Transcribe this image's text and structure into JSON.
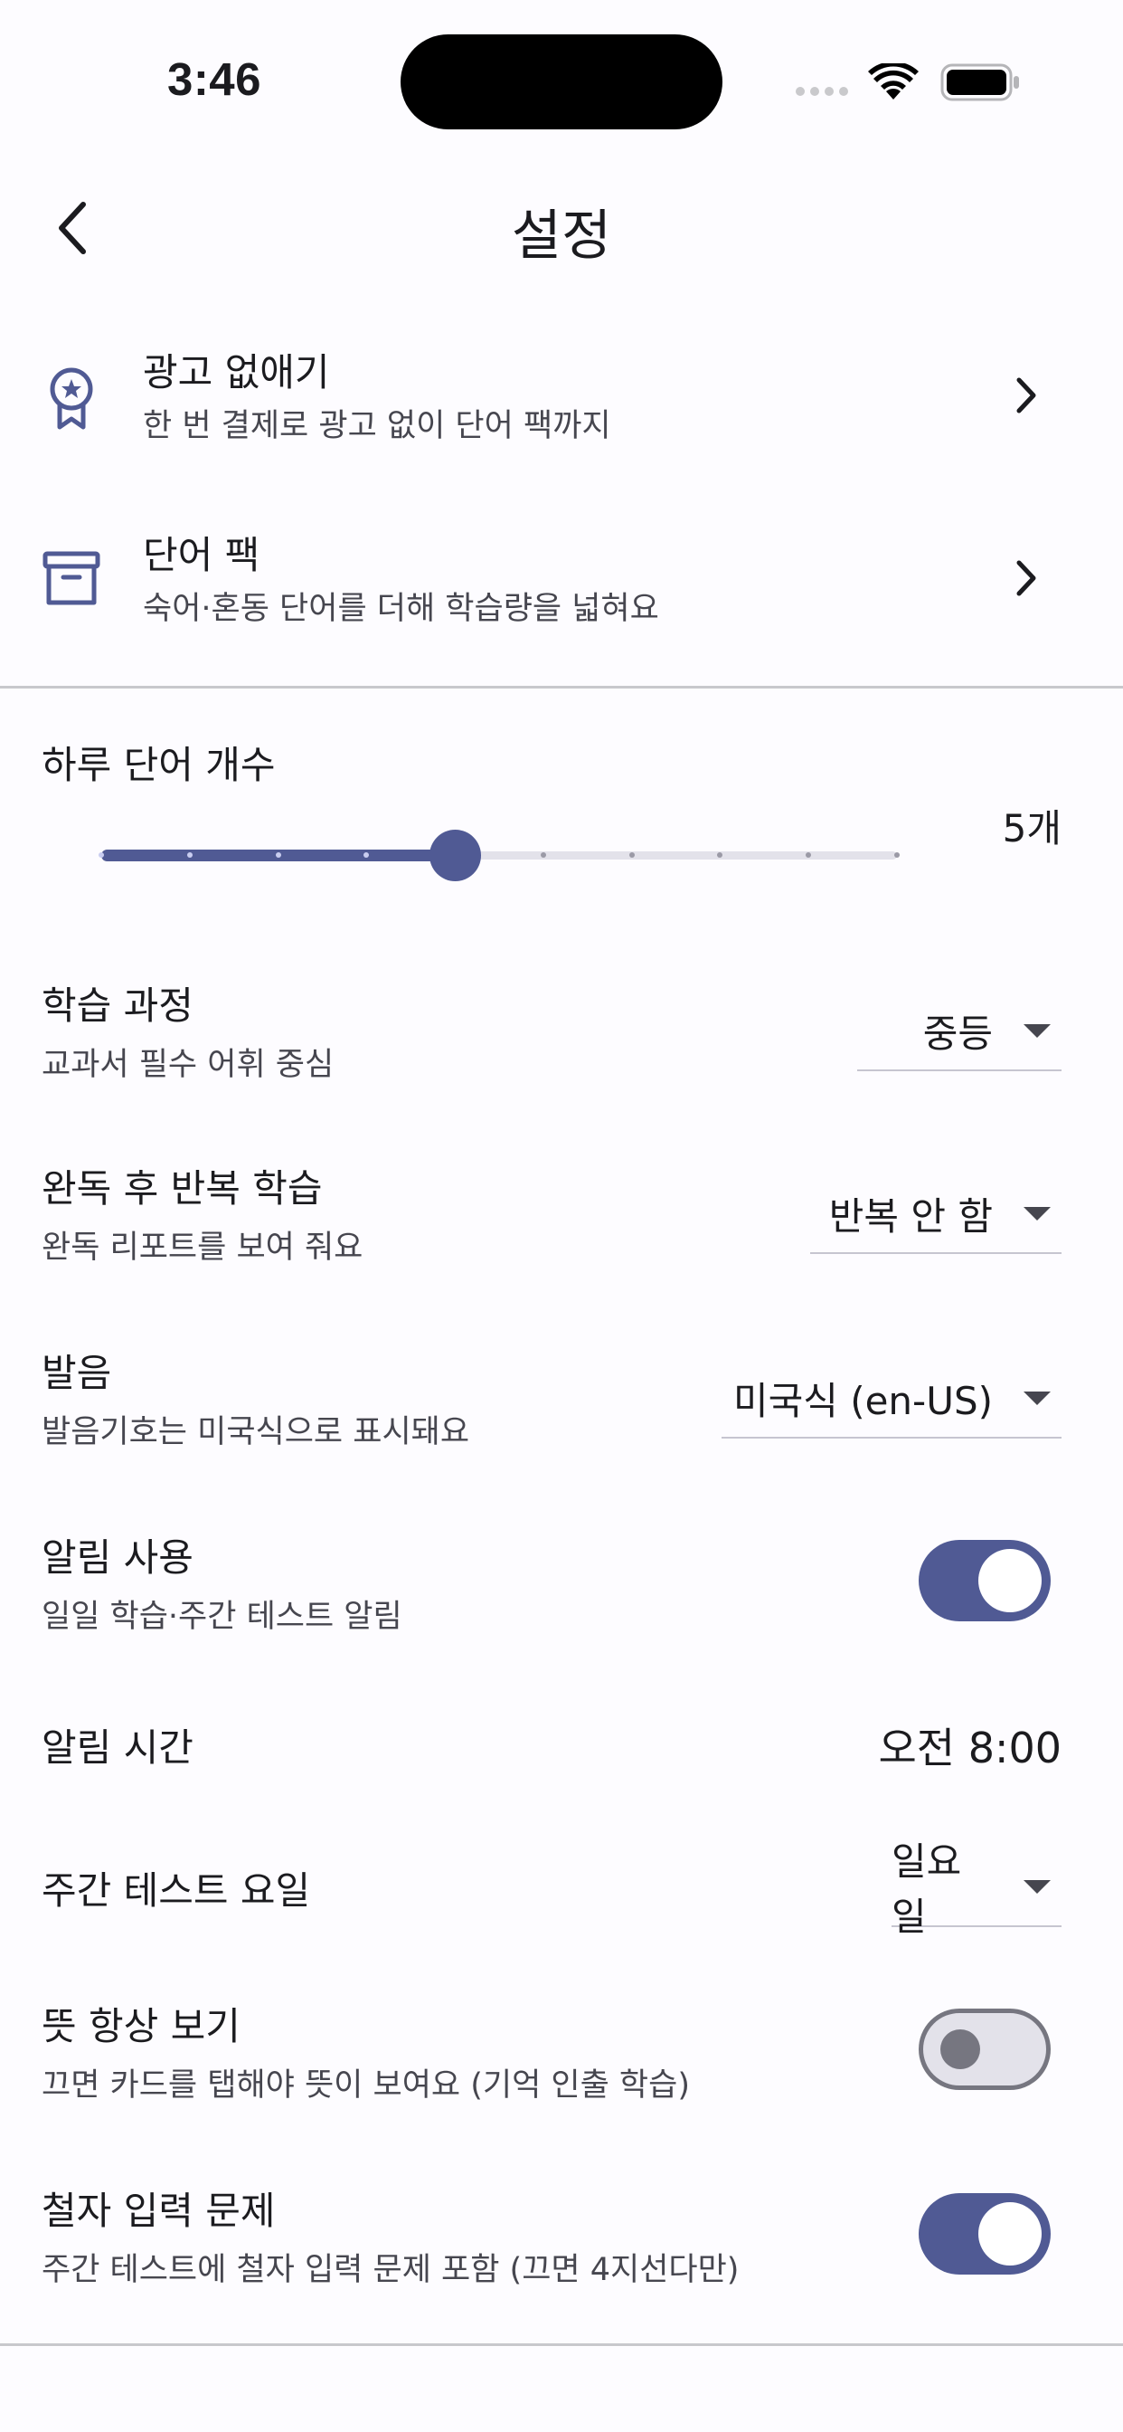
{
  "status_bar": {
    "time": "3:46"
  },
  "app_bar": {
    "title": "설정"
  },
  "nav_items": [
    {
      "title": "광고 없애기",
      "subtitle": "한 번 결제로 광고 없이 단어 팩까지",
      "icon": "award-ribbon-icon"
    },
    {
      "title": "단어 팩",
      "subtitle": "숙어·혼동 단어를 더해 학습량을 넓혀요",
      "icon": "archive-box-icon"
    }
  ],
  "daily_words": {
    "label": "하루 단어 개수",
    "value_label": "5개",
    "value": 5,
    "steps": 10
  },
  "course": {
    "title": "학습 과정",
    "subtitle": "교과서 필수 어휘 중심",
    "selected": "중등"
  },
  "repeat": {
    "title": "완독 후 반복 학습",
    "subtitle": "완독 리포트를 보여 줘요",
    "selected": "반복 안 함"
  },
  "pronunciation": {
    "title": "발음",
    "subtitle": "발음기호는 미국식으로 표시돼요",
    "selected": "미국식 (en-US)"
  },
  "notifications": {
    "title": "알림 사용",
    "subtitle": "일일 학습·주간 테스트 알림",
    "enabled": true
  },
  "notification_time": {
    "title": "알림 시간",
    "value": "오전 8:00"
  },
  "test_day": {
    "title": "주간 테스트 요일",
    "selected": "일요일"
  },
  "always_meaning": {
    "title": "뜻 항상 보기",
    "subtitle": "끄면 카드를 탭해야 뜻이 보여요 (기억 인출 학습)",
    "enabled": false
  },
  "spelling_quiz": {
    "title": "철자 입력 문제",
    "subtitle": "주간 테스트에 철자 입력 문제 포함 (끄면 4지선다만)",
    "enabled": true
  },
  "colors": {
    "accent": "#505a94",
    "track_inactive": "#e3e2ea",
    "divider": "#c8c8cc"
  }
}
